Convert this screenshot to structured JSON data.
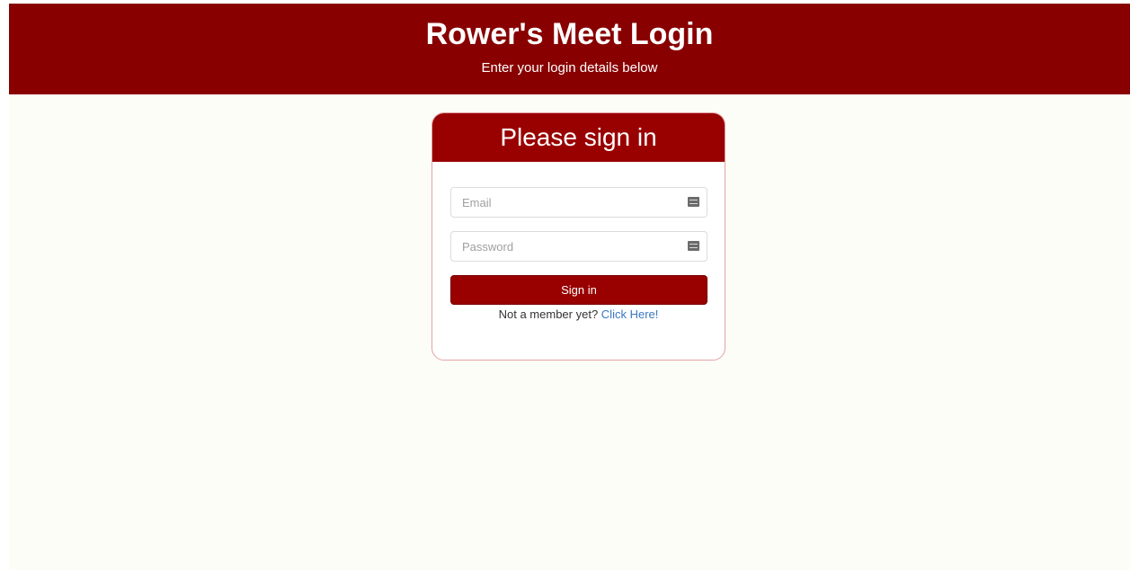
{
  "header": {
    "title": "Rower's Meet Login",
    "subtitle": "Enter your login details below"
  },
  "card": {
    "heading": "Please sign in",
    "email": {
      "placeholder": "Email",
      "value": ""
    },
    "password": {
      "placeholder": "Password",
      "value": ""
    },
    "signin_label": "Sign in",
    "member_prompt": "Not a member yet?",
    "signup_link": "Click Here!"
  },
  "colors": {
    "header_bg": "#880000",
    "card_header_bg": "#990000",
    "link": "#3a78c2",
    "page_bg": "#fdfdf8"
  },
  "icons": [
    "key-icon",
    "key-icon"
  ]
}
